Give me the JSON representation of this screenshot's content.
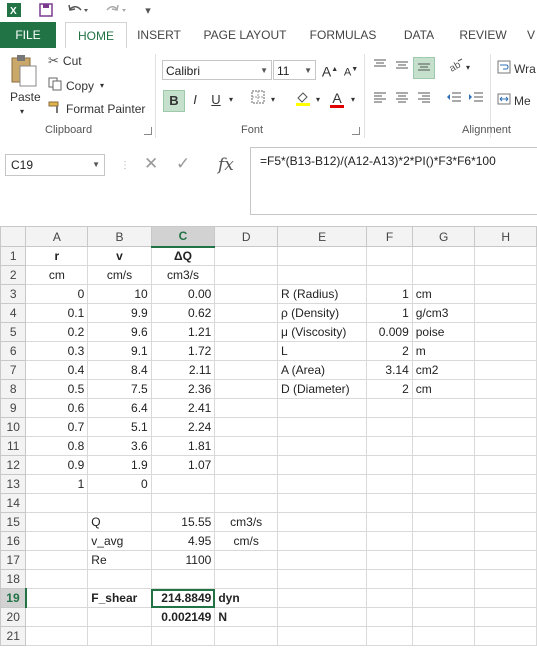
{
  "qat": {
    "undo_label": "Undo",
    "redo_label": "Redo"
  },
  "tabs": [
    "FILE",
    "HOME",
    "INSERT",
    "PAGE LAYOUT",
    "FORMULAS",
    "DATA",
    "REVIEW",
    "V"
  ],
  "ribbon": {
    "clipboard": {
      "paste": "Paste",
      "cut": "Cut",
      "copy": "Copy",
      "format_painter": "Format Painter",
      "label": "Clipboard"
    },
    "font": {
      "name": "Calibri",
      "size": "11",
      "bold": "B",
      "italic": "I",
      "underline": "U",
      "grow": "A",
      "shrink": "A",
      "font_color": "A",
      "label": "Font"
    },
    "alignment": {
      "wrap": "Wra",
      "merge": "Me",
      "label": "Alignment"
    }
  },
  "formula_bar": {
    "name_box": "C19",
    "fx": "fx",
    "formula": "=F5*(B13-B12)/(A12-A13)*2*PI()*F3*F6*100"
  },
  "columns": [
    "A",
    "B",
    "C",
    "D",
    "E",
    "F",
    "G",
    "H"
  ],
  "rows": [
    {
      "n": "1",
      "cells": [
        "r",
        "v",
        "ΔQ",
        "",
        "",
        "",
        "",
        ""
      ]
    },
    {
      "n": "2",
      "cells": [
        "cm",
        "cm/s",
        "cm3/s",
        "",
        "",
        "",
        "",
        ""
      ]
    },
    {
      "n": "3",
      "cells": [
        "0",
        "10",
        "0.00",
        "",
        "R (Radius)",
        "1",
        "cm",
        ""
      ]
    },
    {
      "n": "4",
      "cells": [
        "0.1",
        "9.9",
        "0.62",
        "",
        "ρ (Density)",
        "1",
        "g/cm3",
        ""
      ]
    },
    {
      "n": "5",
      "cells": [
        "0.2",
        "9.6",
        "1.21",
        "",
        "μ (Viscosity)",
        "0.009",
        "poise",
        ""
      ]
    },
    {
      "n": "6",
      "cells": [
        "0.3",
        "9.1",
        "1.72",
        "",
        "L",
        "2",
        "m",
        ""
      ]
    },
    {
      "n": "7",
      "cells": [
        "0.4",
        "8.4",
        "2.11",
        "",
        "A (Area)",
        "3.14",
        "cm2",
        ""
      ]
    },
    {
      "n": "8",
      "cells": [
        "0.5",
        "7.5",
        "2.36",
        "",
        "D (Diameter)",
        "2",
        "cm",
        ""
      ]
    },
    {
      "n": "9",
      "cells": [
        "0.6",
        "6.4",
        "2.41",
        "",
        "",
        "",
        "",
        ""
      ]
    },
    {
      "n": "10",
      "cells": [
        "0.7",
        "5.1",
        "2.24",
        "",
        "",
        "",
        "",
        ""
      ]
    },
    {
      "n": "11",
      "cells": [
        "0.8",
        "3.6",
        "1.81",
        "",
        "",
        "",
        "",
        ""
      ]
    },
    {
      "n": "12",
      "cells": [
        "0.9",
        "1.9",
        "1.07",
        "",
        "",
        "",
        "",
        ""
      ]
    },
    {
      "n": "13",
      "cells": [
        "1",
        "0",
        "",
        "",
        "",
        "",
        "",
        ""
      ]
    },
    {
      "n": "14",
      "cells": [
        "",
        "",
        "",
        "",
        "",
        "",
        "",
        ""
      ]
    },
    {
      "n": "15",
      "cells": [
        "",
        "Q",
        "15.55",
        "cm3/s",
        "",
        "",
        "",
        ""
      ]
    },
    {
      "n": "16",
      "cells": [
        "",
        "v_avg",
        "4.95",
        "cm/s",
        "",
        "",
        "",
        ""
      ]
    },
    {
      "n": "17",
      "cells": [
        "",
        "Re",
        "1100",
        "",
        "",
        "",
        "",
        ""
      ]
    },
    {
      "n": "18",
      "cells": [
        "",
        "",
        "",
        "",
        "",
        "",
        "",
        ""
      ]
    },
    {
      "n": "19",
      "cells": [
        "",
        "F_shear",
        "214.8849",
        "dyn",
        "",
        "",
        "",
        ""
      ]
    },
    {
      "n": "20",
      "cells": [
        "",
        "",
        "0.002149",
        "N",
        "",
        "",
        "",
        ""
      ]
    },
    {
      "n": "21",
      "cells": [
        "",
        "",
        "",
        "",
        "",
        "",
        "",
        ""
      ]
    }
  ],
  "colors": {
    "accent": "#217346",
    "header_bg": "#f3f3f3",
    "selected_header_bg": "#d2d2d2"
  }
}
